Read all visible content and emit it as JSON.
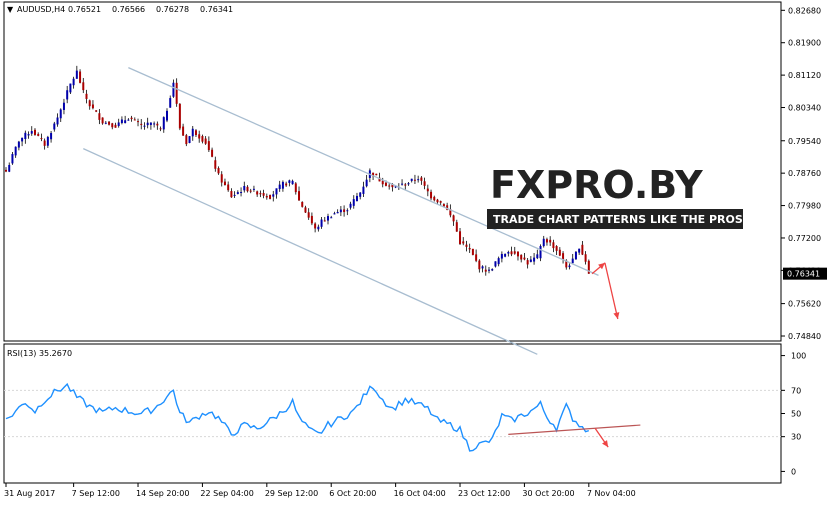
{
  "chart_data": [
    {
      "type": "candlestick",
      "symbol_timeframe": "AUDUSD,H4",
      "header_ohlc": [
        "0.76521",
        "0.76566",
        "0.76278",
        "0.76341"
      ],
      "current_price_label": "0.76341",
      "y_ticks": [
        "0.82680",
        "0.81900",
        "0.81120",
        "0.80340",
        "0.79540",
        "0.78760",
        "0.77980",
        "0.77200",
        "0.76420",
        "0.75620",
        "0.74840"
      ],
      "ylim": [
        0.7472,
        0.8288
      ],
      "x_tick_labels": [
        "31 Aug 2017",
        "7 Sep 12:00",
        "14 Sep 20:00",
        "22 Sep 04:00",
        "29 Sep 12:00",
        "6 Oct 20:00",
        "16 Oct 04:00",
        "23 Oct 12:00",
        "30 Oct 20:00",
        "7 Nov 04:00"
      ],
      "x_tick_bar_index": [
        0,
        21,
        41,
        61,
        81,
        101,
        121,
        141,
        161,
        181
      ],
      "bar_count": 182,
      "close_anchors": [
        [
          0,
          0.788
        ],
        [
          4,
          0.7955
        ],
        [
          8,
          0.798
        ],
        [
          12,
          0.7945
        ],
        [
          16,
          0.801
        ],
        [
          20,
          0.809
        ],
        [
          22,
          0.812
        ],
        [
          24,
          0.807
        ],
        [
          26,
          0.804
        ],
        [
          30,
          0.8
        ],
        [
          34,
          0.799
        ],
        [
          38,
          0.801
        ],
        [
          42,
          0.799
        ],
        [
          46,
          0.7995
        ],
        [
          48,
          0.798
        ],
        [
          50,
          0.803
        ],
        [
          52,
          0.8095
        ],
        [
          54,
          0.7985
        ],
        [
          56,
          0.795
        ],
        [
          58,
          0.798
        ],
        [
          62,
          0.795
        ],
        [
          66,
          0.787
        ],
        [
          70,
          0.782
        ],
        [
          74,
          0.784
        ],
        [
          78,
          0.783
        ],
        [
          82,
          0.782
        ],
        [
          86,
          0.785
        ],
        [
          89,
          0.7855
        ],
        [
          91,
          0.781
        ],
        [
          94,
          0.777
        ],
        [
          96,
          0.774
        ],
        [
          98,
          0.776
        ],
        [
          102,
          0.778
        ],
        [
          106,
          0.779
        ],
        [
          110,
          0.783
        ],
        [
          113,
          0.788
        ],
        [
          116,
          0.786
        ],
        [
          120,
          0.784
        ],
        [
          124,
          0.785
        ],
        [
          128,
          0.7865
        ],
        [
          132,
          0.782
        ],
        [
          136,
          0.78
        ],
        [
          139,
          0.776
        ],
        [
          141,
          0.771
        ],
        [
          144,
          0.769
        ],
        [
          147,
          0.765
        ],
        [
          150,
          0.764
        ],
        [
          153,
          0.767
        ],
        [
          156,
          0.769
        ],
        [
          159,
          0.768
        ],
        [
          162,
          0.766
        ],
        [
          165,
          0.7675
        ],
        [
          167,
          0.772
        ],
        [
          170,
          0.77
        ],
        [
          172,
          0.768
        ],
        [
          174,
          0.765
        ],
        [
          176,
          0.7665
        ],
        [
          178,
          0.77
        ],
        [
          180,
          0.7665
        ],
        [
          181,
          0.7634
        ]
      ],
      "channel_upper": {
        "from": [
          38,
          0.813
        ],
        "to": [
          184,
          0.763
        ]
      },
      "channel_lower": {
        "from": [
          24,
          0.7935
        ],
        "to": [
          165,
          0.744
        ]
      },
      "forecast_arrows": [
        {
          "from": [
            182,
            0.7634
          ],
          "to": [
            186,
            0.766
          ]
        },
        {
          "from": [
            186,
            0.766
          ],
          "to": [
            190,
            0.7525
          ]
        }
      ],
      "colors": {
        "bull": "#0000aa",
        "bear": "#aa0000",
        "wick": "#000000",
        "channel": "#a8bdd0",
        "arrow": "#ee4444",
        "last_price_bg": "#000000"
      }
    },
    {
      "type": "line",
      "title": "RSI(13) 35.2670",
      "y_ticks": [
        "100",
        "70",
        "50",
        "30",
        "0"
      ],
      "ylim": [
        -10,
        110
      ],
      "anchors": [
        [
          0,
          44
        ],
        [
          3,
          52
        ],
        [
          6,
          60
        ],
        [
          9,
          52
        ],
        [
          12,
          62
        ],
        [
          16,
          70
        ],
        [
          19,
          74
        ],
        [
          22,
          64
        ],
        [
          26,
          56
        ],
        [
          30,
          51
        ],
        [
          34,
          55
        ],
        [
          38,
          52
        ],
        [
          42,
          50
        ],
        [
          46,
          54
        ],
        [
          49,
          62
        ],
        [
          52,
          70
        ],
        [
          54,
          50
        ],
        [
          57,
          42
        ],
        [
          60,
          48
        ],
        [
          63,
          52
        ],
        [
          66,
          46
        ],
        [
          70,
          32
        ],
        [
          74,
          40
        ],
        [
          78,
          37
        ],
        [
          82,
          44
        ],
        [
          86,
          52
        ],
        [
          89,
          60
        ],
        [
          91,
          46
        ],
        [
          94,
          36
        ],
        [
          97,
          32
        ],
        [
          100,
          40
        ],
        [
          104,
          46
        ],
        [
          108,
          52
        ],
        [
          112,
          68
        ],
        [
          114,
          74
        ],
        [
          117,
          62
        ],
        [
          120,
          54
        ],
        [
          124,
          62
        ],
        [
          128,
          58
        ],
        [
          131,
          54
        ],
        [
          134,
          44
        ],
        [
          138,
          40
        ],
        [
          141,
          36
        ],
        [
          144,
          20
        ],
        [
          148,
          24
        ],
        [
          151,
          27
        ],
        [
          154,
          48
        ],
        [
          157,
          44
        ],
        [
          160,
          48
        ],
        [
          163,
          52
        ],
        [
          166,
          58
        ],
        [
          168,
          47
        ],
        [
          171,
          38
        ],
        [
          174,
          56
        ],
        [
          176,
          46
        ],
        [
          179,
          38
        ],
        [
          181,
          35.27
        ]
      ],
      "trendline": {
        "from": [
          156,
          32
        ],
        "to": [
          197,
          40
        ]
      },
      "forecast_arrow": {
        "from": [
          183,
          37
        ],
        "to": [
          187,
          21
        ]
      },
      "colors": {
        "line": "#1e90ff",
        "trend": "#bb5555",
        "arrow": "#ee4444"
      }
    }
  ],
  "logo": {
    "title": "FXPRO.BY",
    "tagline": "TRADE CHART PATTERNS LIKE THE PROS",
    "colors": {
      "dark": "#222222",
      "accent": "#e03a3a",
      "light": "#ffffff"
    }
  }
}
